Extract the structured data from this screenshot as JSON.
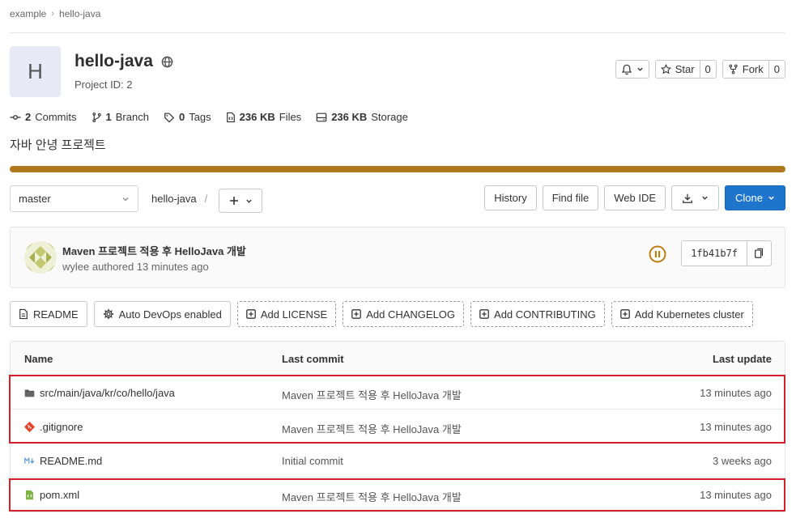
{
  "breadcrumb": {
    "group": "example",
    "project": "hello-java"
  },
  "project": {
    "initial": "H",
    "name": "hello-java",
    "id_label": "Project ID: 2",
    "description": "자바 안녕 프로젝트"
  },
  "header_buttons": {
    "star_label": "Star",
    "star_count": "0",
    "fork_label": "Fork",
    "fork_count": "0"
  },
  "stats": {
    "commits_count": "2",
    "commits_label": "Commits",
    "branch_count": "1",
    "branch_label": "Branch",
    "tags_count": "0",
    "tags_label": "Tags",
    "files_size": "236 KB",
    "files_label": "Files",
    "storage_size": "236 KB",
    "storage_label": "Storage"
  },
  "toolbar": {
    "branch": "master",
    "path_root": "hello-java",
    "path_sep": "/",
    "history": "History",
    "find_file": "Find file",
    "web_ide": "Web IDE",
    "clone": "Clone"
  },
  "last_commit": {
    "title": "Maven 프로젝트 적용 후 HelloJava 개발",
    "author_line": "wylee authored 13 minutes ago",
    "sha": "1fb41b7f"
  },
  "badges": {
    "readme": "README",
    "autodevops": "Auto DevOps enabled",
    "license": "Add LICENSE",
    "changelog": "Add CHANGELOG",
    "contributing": "Add CONTRIBUTING",
    "kubernetes": "Add Kubernetes cluster"
  },
  "files_table": {
    "headers": {
      "name": "Name",
      "commit": "Last commit",
      "update": "Last update"
    },
    "rows": [
      {
        "name": "src/main/java/kr/co/hello/java",
        "icon": "folder-icon",
        "commit": "Maven 프로젝트 적용 후 HelloJava 개발",
        "update": "13 minutes ago"
      },
      {
        "name": ".gitignore",
        "icon": "git-icon",
        "commit": "Maven 프로젝트 적용 후 HelloJava 개발",
        "update": "13 minutes ago"
      },
      {
        "name": "README.md",
        "icon": "markdown-icon",
        "commit": "Initial commit",
        "update": "3 weeks ago"
      },
      {
        "name": "pom.xml",
        "icon": "xml-file-icon",
        "commit": "Maven 프로젝트 적용 후 HelloJava 개발",
        "update": "13 minutes ago"
      }
    ]
  },
  "colors": {
    "accent": "#1f75cb",
    "progress": "#b0781d",
    "highlight": "#d5202c",
    "pipeline": "#c17d10"
  }
}
